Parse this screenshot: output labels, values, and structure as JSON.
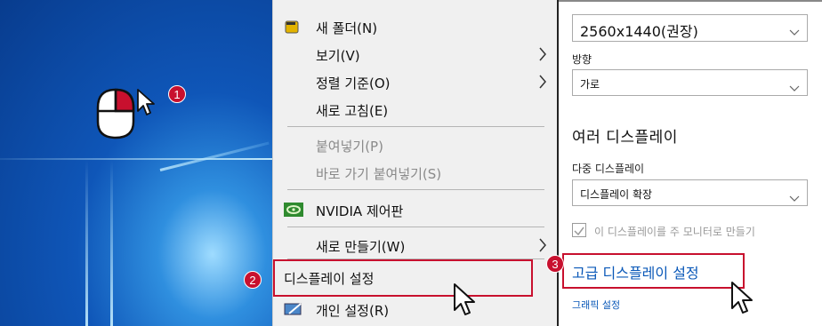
{
  "badges": {
    "one": "1",
    "two": "2",
    "three": "3"
  },
  "menu": {
    "new_folder": "새 폴더(N)",
    "view": "보기(V)",
    "sort_by": "정렬 기준(O)",
    "refresh": "새로 고침(E)",
    "paste": "붙여넣기(P)",
    "paste_shortcut": "바로 가기 붙여넣기(S)",
    "nvidia": "NVIDIA 제어판",
    "new": "새로 만들기(W)",
    "display_settings": "디스플레이 설정",
    "personalize": "개인 설정(R)"
  },
  "settings": {
    "resolution_value": "2560x1440(권장)",
    "orientation_label": "방향",
    "orientation_value": "가로",
    "multi_display_title": "여러 디스플레이",
    "multi_display_label": "다중 디스플레이",
    "multi_display_value": "디스플레이 확장",
    "main_display_checkbox": "이 디스플레이를 주 모니터로 만들기",
    "advanced_link": "고급 디스플레이 설정",
    "graphics_link": "그래픽 설정"
  },
  "colors": {
    "accent_red": "#c8102e",
    "link_blue": "#0a58b8"
  },
  "icons": [
    "mouse-icon",
    "cursor-icon",
    "folder-icon",
    "nvidia-icon",
    "personalize-icon",
    "chevron-right-icon",
    "chevron-down-icon"
  ]
}
